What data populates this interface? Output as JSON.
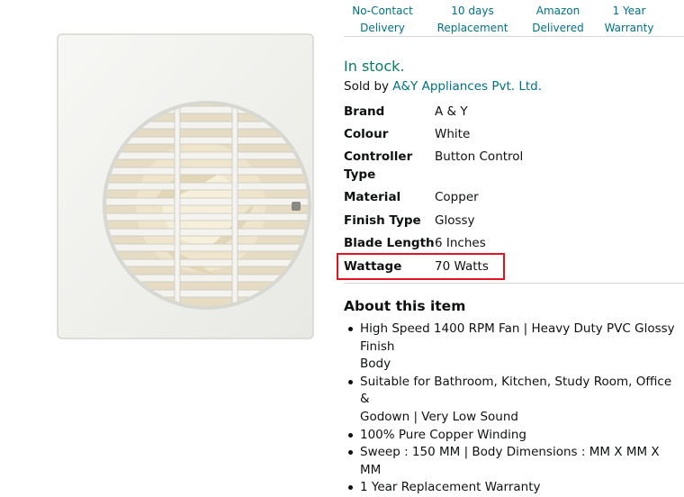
{
  "badges": [
    {
      "line1": "No-Contact",
      "line2": "Delivery"
    },
    {
      "line1": "10 days",
      "line2": "Replacement"
    },
    {
      "line1": "Amazon",
      "line2": "Delivered"
    },
    {
      "line1": "1 Year",
      "line2": "Warranty"
    }
  ],
  "availability": "In stock.",
  "sold_by": {
    "prefix": "Sold by ",
    "seller": "A&Y Appliances Pvt. Ltd."
  },
  "specs": [
    {
      "label": "Brand",
      "value": "A & Y"
    },
    {
      "label": "Colour",
      "value": "White"
    },
    {
      "label": "Controller",
      "label2": "Type",
      "value": "Button Control"
    },
    {
      "label": "Material",
      "value": "Copper"
    },
    {
      "label": "Finish Type",
      "value": "Glossy"
    },
    {
      "label": "Blade Length",
      "value": "6 Inches"
    },
    {
      "label": "Wattage",
      "value": "70 Watts"
    }
  ],
  "about": {
    "title": "About this item",
    "bullets": [
      {
        "line1": "High Speed 1400 RPM Fan | Heavy Duty PVC Glossy Finish",
        "line2": "Body"
      },
      {
        "line1": "Suitable for Bathroom, Kitchen, Study Room, Office &",
        "line2": "Godown | Very Low Sound"
      },
      {
        "line1": "100% Pure Copper Winding"
      },
      {
        "line1": "Sweep : 150 MM | Body Dimensions : MM X MM X MM"
      },
      {
        "line1": "1 Year Replacement Warranty"
      }
    ]
  },
  "colors": {
    "link": "#007185",
    "in_stock": "#067d62",
    "highlight": "#e3121f",
    "text": "#0f1111"
  }
}
